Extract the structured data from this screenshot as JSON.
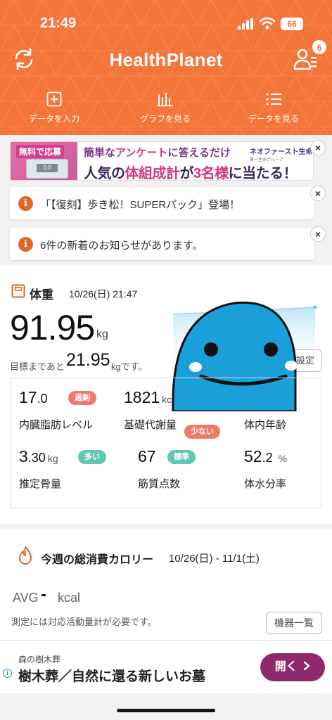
{
  "status_bar": {
    "time": "21:49",
    "battery": "66"
  },
  "header": {
    "logo": "HealthPlanet",
    "notification_count": "6",
    "nav": [
      {
        "label": "データを入力",
        "icon": "plus-square-icon"
      },
      {
        "label": "グラフを見る",
        "icon": "bar-chart-icon"
      },
      {
        "label": "データを見る",
        "icon": "list-icon"
      }
    ],
    "accent_color": "#f4753a"
  },
  "promo_banner": {
    "badge": "無料で応募",
    "scale_display": "0.0",
    "line1_pre": "簡単な",
    "line1_highlight": "アンケート",
    "line1_post": "に答えるだけ",
    "brand": "ネオファースト生命",
    "brand_sub": "第一生命グループ",
    "line2_a": "人気の",
    "line2_b": "体組成計",
    "line2_c": "が",
    "line2_d": "3名様",
    "line2_e": "に当たる！"
  },
  "notices": [
    {
      "text": "「【復刻】歩き松！SUPERパック」登場！"
    },
    {
      "text": "6件の新着のお知らせがあります。"
    }
  ],
  "close_label": "×",
  "weight": {
    "title": "体重",
    "datetime": "10/26(日) 21:47",
    "value": "91.95",
    "unit": "kg",
    "goal_prefix": "目標まであと",
    "goal_value": "21.95",
    "goal_suffix": "kgです。",
    "settings_label": "設定",
    "metrics": [
      {
        "value": "17",
        "decimal": ".0",
        "unit": "",
        "tag": "過剰",
        "tag_color": "#f07a6a",
        "label": "内臓脂肪レベル"
      },
      {
        "value": "1821",
        "decimal": "",
        "unit": "kc",
        "tag": "少ない",
        "tag_color": "#f07a6a",
        "label": "基礎代謝量"
      },
      {
        "value": "",
        "decimal": "",
        "unit": "",
        "tag": "",
        "tag_color": "",
        "label": "体内年齢"
      },
      {
        "value": "3",
        "decimal": ".30",
        "unit": "kg",
        "tag": "多い",
        "tag_color": "#62c6b4",
        "label": "推定骨量"
      },
      {
        "value": "67",
        "decimal": "",
        "unit": "",
        "tag": "標準",
        "tag_color": "#62c6b4",
        "label": "筋質点数"
      },
      {
        "value": "52",
        "decimal": ".2",
        "unit": "%",
        "tag": "",
        "tag_color": "",
        "label": "体水分率"
      }
    ]
  },
  "calories": {
    "title": "今週の総消費カロリー",
    "range": "10/26(日) - 11/1(土)",
    "avg_label": "AVG",
    "avg_value": "-",
    "avg_unit": "kcal",
    "note": "測定には対応活動量計が必要です。",
    "devices_label": "機器一覧"
  },
  "ad": {
    "sponsor": "森の樹木葬",
    "headline": "樹木葬／自然に還る新しいお墓",
    "button": "開く",
    "button_icon": "chevron-right-icon",
    "info_icon": "i"
  }
}
